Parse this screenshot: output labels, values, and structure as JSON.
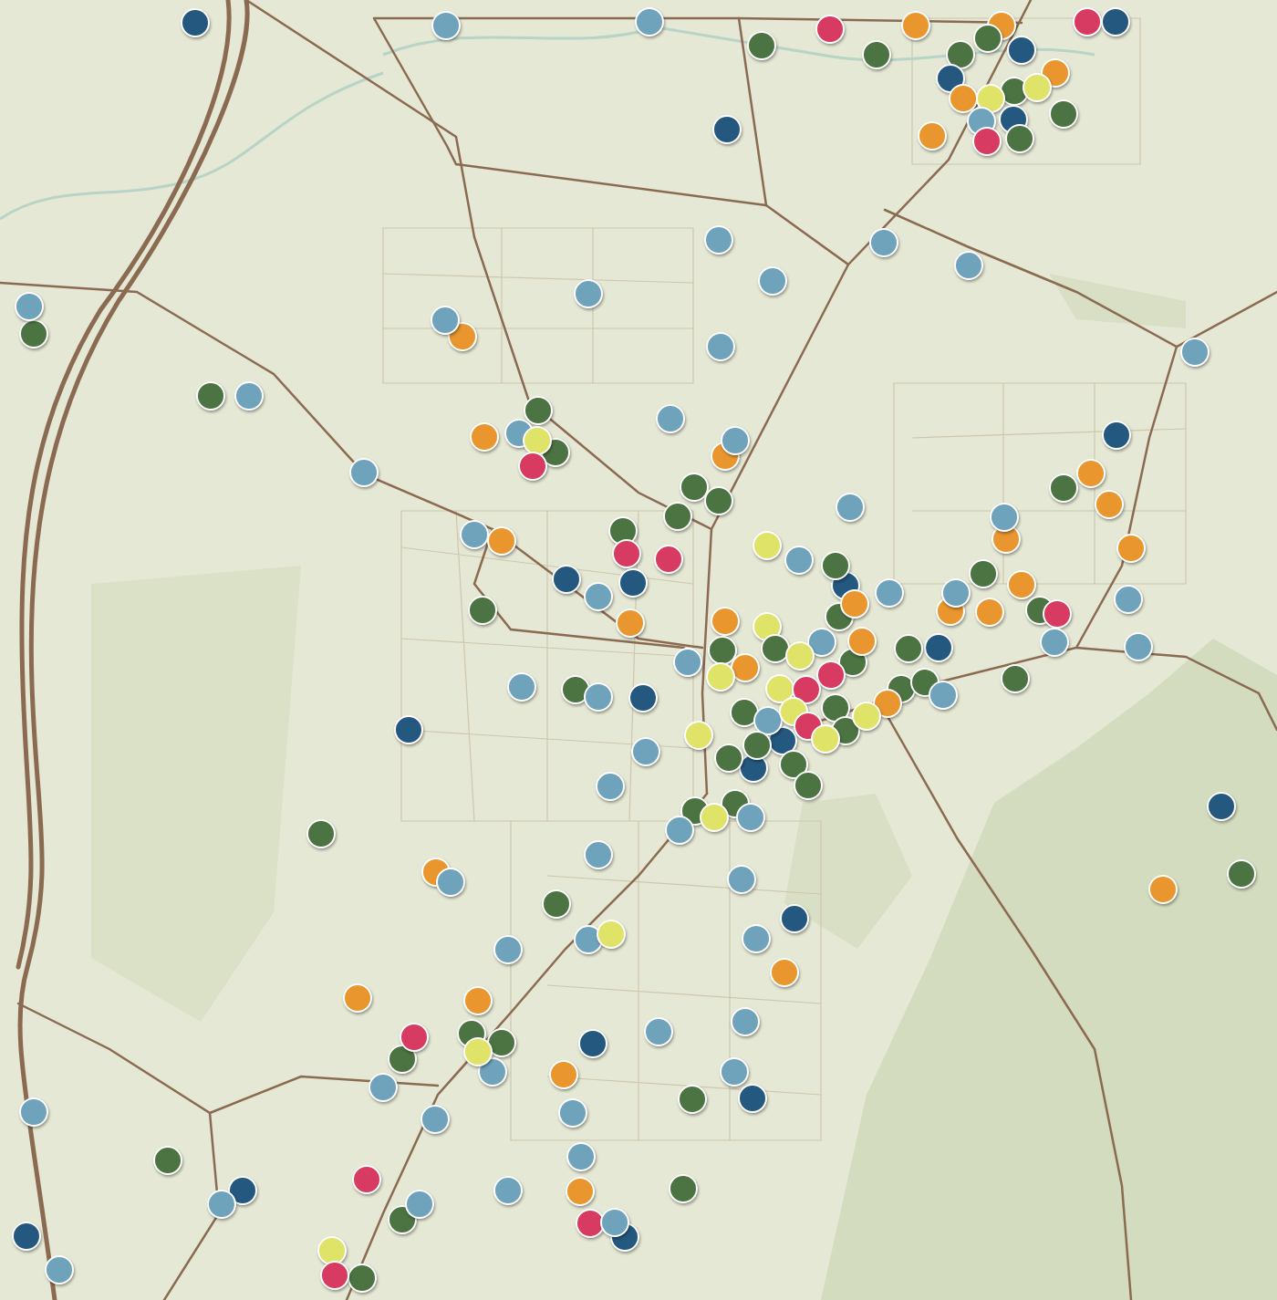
{
  "map": {
    "pins": [
      {
        "color": "#24587e"
      },
      {
        "color": "#6fa3bb"
      },
      {
        "color": "#6fa3bb"
      },
      {
        "color": "#4b7442"
      },
      {
        "color": "#d73b62"
      },
      {
        "color": "#e9962f"
      },
      {
        "color": "#4b7442"
      },
      {
        "color": "#e9962f"
      },
      {
        "color": "#d73b62"
      },
      {
        "color": "#24587e"
      },
      {
        "color": "#4b7442"
      },
      {
        "color": "#4b7442"
      },
      {
        "color": "#24587e"
      },
      {
        "color": "#e9962f"
      },
      {
        "color": "#24587e"
      },
      {
        "color": "#e9962f"
      },
      {
        "color": "#4b7442"
      },
      {
        "color": "#dfe368"
      },
      {
        "color": "#dfe368"
      },
      {
        "color": "#6fa3bb"
      },
      {
        "color": "#24587e"
      },
      {
        "color": "#4b7442"
      },
      {
        "color": "#e9962f"
      },
      {
        "color": "#d73b62"
      },
      {
        "color": "#4b7442"
      },
      {
        "color": "#24587e"
      },
      {
        "color": "#6fa3bb"
      },
      {
        "color": "#6fa3bb"
      },
      {
        "color": "#6fa3bb"
      },
      {
        "color": "#6fa3bb"
      },
      {
        "color": "#6fa3bb"
      },
      {
        "color": "#4b7442"
      },
      {
        "color": "#6fa3bb"
      },
      {
        "color": "#e9962f"
      },
      {
        "color": "#6fa3bb"
      },
      {
        "color": "#6fa3bb"
      },
      {
        "color": "#6fa3bb"
      },
      {
        "color": "#4b7442"
      },
      {
        "color": "#6fa3bb"
      },
      {
        "color": "#6fa3bb"
      },
      {
        "color": "#4b7442"
      },
      {
        "color": "#e9962f"
      },
      {
        "color": "#4b7442"
      },
      {
        "color": "#6fa3bb"
      },
      {
        "color": "#dfe368"
      },
      {
        "color": "#d73b62"
      },
      {
        "color": "#e9962f"
      },
      {
        "color": "#6fa3bb"
      },
      {
        "color": "#6fa3bb"
      },
      {
        "color": "#24587e"
      },
      {
        "color": "#e9962f"
      },
      {
        "color": "#4b7442"
      },
      {
        "color": "#4b7442"
      },
      {
        "color": "#4b7442"
      },
      {
        "color": "#4b7442"
      },
      {
        "color": "#6fa3bb"
      },
      {
        "color": "#e9962f"
      },
      {
        "color": "#e9962f"
      },
      {
        "color": "#6fa3bb"
      },
      {
        "color": "#e9962f"
      },
      {
        "color": "#6fa3bb"
      },
      {
        "color": "#e9962f"
      },
      {
        "color": "#4b7442"
      },
      {
        "color": "#d73b62"
      },
      {
        "color": "#d73b62"
      },
      {
        "color": "#dfe368"
      },
      {
        "color": "#6fa3bb"
      },
      {
        "color": "#24587e"
      },
      {
        "color": "#4b7442"
      },
      {
        "color": "#24587e"
      },
      {
        "color": "#24587e"
      },
      {
        "color": "#6fa3bb"
      },
      {
        "color": "#4b7442"
      },
      {
        "color": "#e9962f"
      },
      {
        "color": "#6fa3bb"
      },
      {
        "color": "#e9962f"
      },
      {
        "color": "#6fa3bb"
      },
      {
        "color": "#e9962f"
      },
      {
        "color": "#4b7442"
      },
      {
        "color": "#d73b62"
      },
      {
        "color": "#6fa3bb"
      },
      {
        "color": "#4b7442"
      },
      {
        "color": "#e9962f"
      },
      {
        "color": "#e9962f"
      },
      {
        "color": "#4b7442"
      },
      {
        "color": "#e9962f"
      },
      {
        "color": "#dfe368"
      },
      {
        "color": "#6fa3bb"
      },
      {
        "color": "#6fa3bb"
      },
      {
        "color": "#24587e"
      },
      {
        "color": "#4b7442"
      },
      {
        "color": "#4b7442"
      },
      {
        "color": "#4b7442"
      },
      {
        "color": "#4b7442"
      },
      {
        "color": "#6fa3bb"
      },
      {
        "color": "#e9962f"
      },
      {
        "color": "#dfe368"
      },
      {
        "color": "#6fa3bb"
      },
      {
        "color": "#e9962f"
      },
      {
        "color": "#dfe368"
      },
      {
        "color": "#d73b62"
      },
      {
        "color": "#4b7442"
      },
      {
        "color": "#6fa3bb"
      },
      {
        "color": "#4b7442"
      },
      {
        "color": "#6fa3bb"
      },
      {
        "color": "#24587e"
      },
      {
        "color": "#24587e"
      },
      {
        "color": "#dfe368"
      },
      {
        "color": "#d73b62"
      },
      {
        "color": "#4b7442"
      },
      {
        "color": "#4b7442"
      },
      {
        "color": "#6fa3bb"
      },
      {
        "color": "#e9962f"
      },
      {
        "color": "#4b7442"
      },
      {
        "color": "#4b7442"
      },
      {
        "color": "#6fa3bb"
      },
      {
        "color": "#dfe368"
      },
      {
        "color": "#4b7442"
      },
      {
        "color": "#dfe368"
      },
      {
        "color": "#24587e"
      },
      {
        "color": "#dfe368"
      },
      {
        "color": "#24587e"
      },
      {
        "color": "#4b7442"
      },
      {
        "color": "#4b7442"
      },
      {
        "color": "#4b7442"
      },
      {
        "color": "#d73b62"
      },
      {
        "color": "#dfe368"
      },
      {
        "color": "#6fa3bb"
      },
      {
        "color": "#4b7442"
      },
      {
        "color": "#6fa3bb"
      },
      {
        "color": "#4b7442"
      },
      {
        "color": "#4b7442"
      },
      {
        "color": "#4b7442"
      },
      {
        "color": "#dfe368"
      },
      {
        "color": "#6fa3bb"
      },
      {
        "color": "#6fa3bb"
      },
      {
        "color": "#24587e"
      },
      {
        "color": "#6fa3bb"
      },
      {
        "color": "#e9962f"
      },
      {
        "color": "#6fa3bb"
      },
      {
        "color": "#6fa3bb"
      },
      {
        "color": "#e9962f"
      },
      {
        "color": "#4b7442"
      },
      {
        "color": "#4b7442"
      },
      {
        "color": "#24587e"
      },
      {
        "color": "#6fa3bb"
      },
      {
        "color": "#dfe368"
      },
      {
        "color": "#6fa3bb"
      },
      {
        "color": "#6fa3bb"
      },
      {
        "color": "#e9962f"
      },
      {
        "color": "#e9962f"
      },
      {
        "color": "#e9962f"
      },
      {
        "color": "#6fa3bb"
      },
      {
        "color": "#6fa3bb"
      },
      {
        "color": "#4b7442"
      },
      {
        "color": "#d73b62"
      },
      {
        "color": "#4b7442"
      },
      {
        "color": "#4b7442"
      },
      {
        "color": "#6fa3bb"
      },
      {
        "color": "#dfe368"
      },
      {
        "color": "#24587e"
      },
      {
        "color": "#6fa3bb"
      },
      {
        "color": "#e9962f"
      },
      {
        "color": "#6fa3bb"
      },
      {
        "color": "#4b7442"
      },
      {
        "color": "#24587e"
      },
      {
        "color": "#6fa3bb"
      },
      {
        "color": "#6fa3bb"
      },
      {
        "color": "#6fa3bb"
      },
      {
        "color": "#4b7442"
      },
      {
        "color": "#6fa3bb"
      },
      {
        "color": "#d73b62"
      },
      {
        "color": "#24587e"
      },
      {
        "color": "#6fa3bb"
      },
      {
        "color": "#6fa3bb"
      },
      {
        "color": "#e9962f"
      },
      {
        "color": "#4b7442"
      },
      {
        "color": "#4b7442"
      },
      {
        "color": "#6fa3bb"
      },
      {
        "color": "#d73b62"
      },
      {
        "color": "#24587e"
      },
      {
        "color": "#6fa3bb"
      },
      {
        "color": "#24587e"
      },
      {
        "color": "#6fa3bb"
      },
      {
        "color": "#dfe368"
      },
      {
        "color": "#4b7442"
      },
      {
        "color": "#d73b62"
      }
    ]
  }
}
